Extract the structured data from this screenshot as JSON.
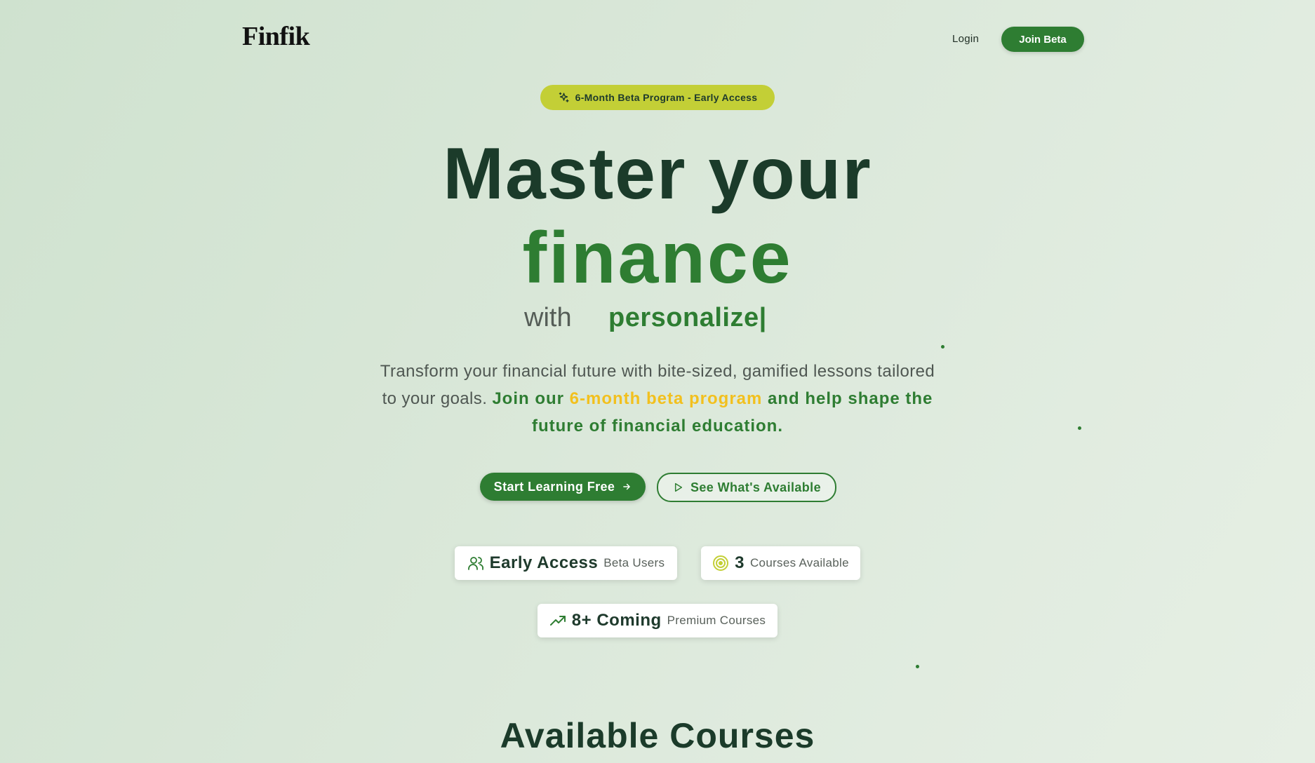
{
  "nav": {
    "logo": "Finfik",
    "login_label": "Login",
    "join_label": "Join Beta"
  },
  "hero": {
    "badge_text": "6-Month Beta Program - Early Access",
    "title_line1": "Master your",
    "title_line2": "finance",
    "with_word": "with",
    "typed_word": "personalize|",
    "description": {
      "part1": "Transform your financial future with bite-sized, gamified lessons tailored to your goals. ",
      "part2": "Join our ",
      "part3": "6-month beta program",
      "part4": " and help shape the future of financial education."
    },
    "primary_cta": "Start Learning Free",
    "secondary_cta": "See What's Available"
  },
  "stats": [
    {
      "big": "Early Access",
      "small": "Beta Users",
      "icon": "users-icon"
    },
    {
      "big": "3",
      "small": "Courses Available",
      "icon": "target-icon"
    },
    {
      "big": "8+ Coming",
      "small": "Premium Courses",
      "icon": "trending-up-icon"
    }
  ],
  "section": {
    "heading": "Available Courses"
  },
  "colors": {
    "brand_green": "#2e7d32",
    "dark_green": "#1b3b2a",
    "badge_lime": "#c3cf36",
    "accent_yellow": "#f2c01e"
  }
}
